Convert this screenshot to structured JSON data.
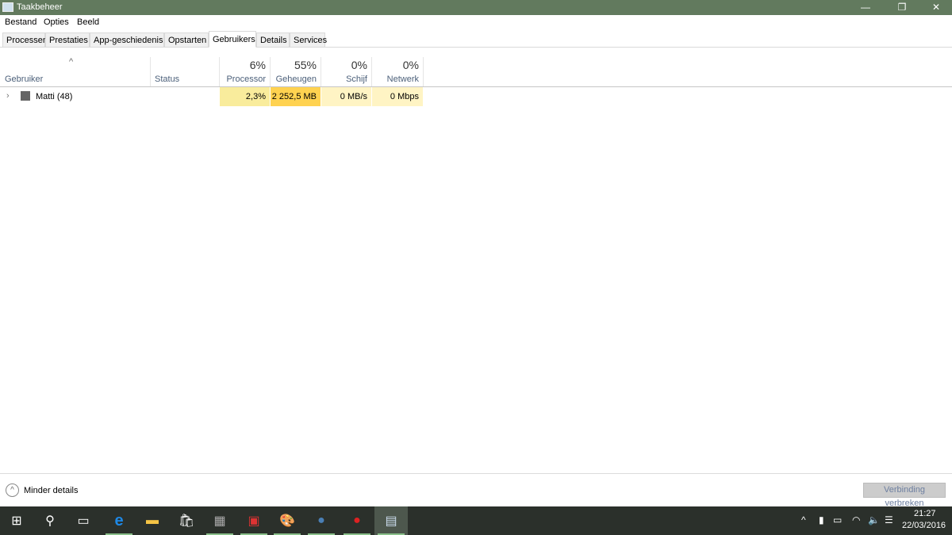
{
  "window": {
    "title": "Taakbeheer",
    "minimize": "—",
    "restore": "❐",
    "close": "✕"
  },
  "menu": [
    "Bestand",
    "Opties",
    "Beeld"
  ],
  "tabs": [
    "Processen",
    "Prestaties",
    "App-geschiedenis",
    "Opstarten",
    "Gebruikers",
    "Details",
    "Services"
  ],
  "active_tab": "Gebruikers",
  "columns": {
    "user": "Gebruiker",
    "status": "Status",
    "cpu": {
      "pct": "6%",
      "label": "Processor"
    },
    "mem": {
      "pct": "55%",
      "label": "Geheugen"
    },
    "disk": {
      "pct": "0%",
      "label": "Schijf"
    },
    "net": {
      "pct": "0%",
      "label": "Netwerk"
    }
  },
  "rows": [
    {
      "name": "Matti (48)",
      "status": "",
      "cpu": "2,3%",
      "mem": "2 252,5 MB",
      "disk": "0 MB/s",
      "net": "0 Mbps"
    }
  ],
  "footer": {
    "less_details": "Minder details",
    "disconnect": "Verbinding verbreken"
  },
  "clock": {
    "time": "21:27",
    "date": "22/03/2016"
  },
  "colors": {
    "titlebar": "#627a5e",
    "heat_light": "#fff4c4",
    "heat_mid": "#f9ec9c",
    "heat_high": "#ffd250",
    "taskbar": "#2b302b"
  }
}
